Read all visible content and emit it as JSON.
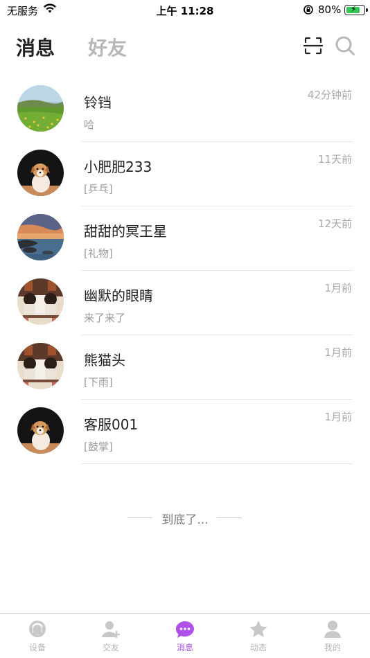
{
  "status_bar": {
    "carrier": "无服务",
    "time": "上午 11:28",
    "battery_percent": "80%"
  },
  "header": {
    "tab_messages": "消息",
    "tab_friends": "好友",
    "scan_icon": "scan-icon",
    "search_icon": "search-icon"
  },
  "conversations": [
    {
      "name": "铃铛",
      "preview": "哈",
      "time": "42分钟前",
      "avatar": "landscape-grass"
    },
    {
      "name": "小肥肥233",
      "preview": "[乒乓]",
      "time": "11天前",
      "avatar": "dog"
    },
    {
      "name": "甜甜的冥王星",
      "preview": "[礼物]",
      "time": "12天前",
      "avatar": "sunset-lake"
    },
    {
      "name": "幽默的眼睛",
      "preview": "来了来了",
      "time": "1月前",
      "avatar": "cartoon-couple"
    },
    {
      "name": "熊猫头",
      "preview": "[下雨]",
      "time": "1月前",
      "avatar": "cartoon-couple"
    },
    {
      "name": "客服001",
      "preview": "[鼓掌]",
      "time": "1月前",
      "avatar": "dog"
    }
  ],
  "end_of_list": "到底了...",
  "tab_bar": {
    "items": [
      {
        "label": "设备",
        "icon": "device-icon"
      },
      {
        "label": "交友",
        "icon": "add-friend-icon"
      },
      {
        "label": "消息",
        "icon": "message-icon"
      },
      {
        "label": "动态",
        "icon": "star-icon"
      },
      {
        "label": "我的",
        "icon": "profile-icon"
      }
    ],
    "active_index": 2,
    "active_color": "#b150e8",
    "inactive_color": "#b5b5b5"
  }
}
